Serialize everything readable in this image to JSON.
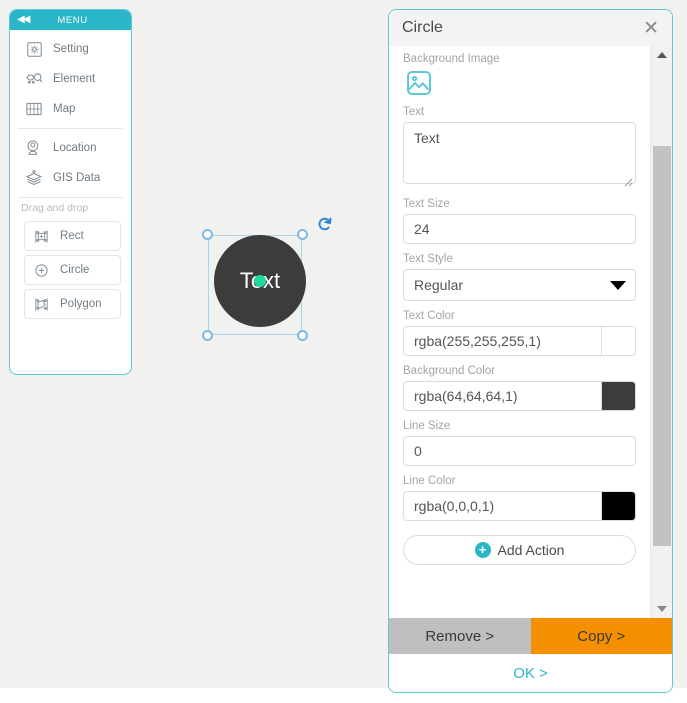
{
  "menu": {
    "title": "MENU",
    "collapse_icon": "double-chevron-left-icon",
    "items": [
      {
        "label": "Setting",
        "icon": "gear-icon"
      },
      {
        "label": "Element",
        "icon": "element-nodes-icon"
      },
      {
        "label": "Map",
        "icon": "grid-map-icon"
      },
      {
        "label": "Location",
        "icon": "location-pin-icon"
      },
      {
        "label": "GIS Data",
        "icon": "layers-icon"
      }
    ],
    "drag_label": "Drag and drop",
    "shapes": [
      {
        "label": "Rect",
        "icon": "rect-shape-icon"
      },
      {
        "label": "Circle",
        "icon": "circle-shape-icon"
      },
      {
        "label": "Polygon",
        "icon": "polygon-shape-icon"
      }
    ]
  },
  "canvas": {
    "background": "#f1f1f0",
    "shape": {
      "type": "circle",
      "text": "Text",
      "fill": "#3c3c3c",
      "text_color": "#ffffff",
      "anchor_color": "#1fd9a0",
      "rotate_icon": "rotate-handle-icon"
    }
  },
  "props": {
    "title": "Circle",
    "close_icon": "close-icon",
    "background_image": {
      "label": "Background Image",
      "icon": "image-placeholder-icon"
    },
    "text": {
      "label": "Text",
      "value": "Text"
    },
    "text_size": {
      "label": "Text Size",
      "value": "24"
    },
    "text_style": {
      "label": "Text Style",
      "value": "Regular",
      "caret_icon": "chevron-down-icon"
    },
    "text_color": {
      "label": "Text Color",
      "value": "rgba(255,255,255,1)",
      "swatch": "#ffffff"
    },
    "background_color": {
      "label": "Background Color",
      "value": "rgba(64,64,64,1)",
      "swatch": "#3c3c3c"
    },
    "line_size": {
      "label": "Line Size",
      "value": "0"
    },
    "line_color": {
      "label": "Line Color",
      "value": "rgba(0,0,0,1)",
      "swatch": "#000000"
    },
    "add_action": {
      "label": "Add Action",
      "icon": "plus-circle-icon"
    },
    "scrollbar": {
      "up_icon": "triangle-up-icon",
      "down_icon": "triangle-down-icon"
    },
    "footer": {
      "remove": "Remove >",
      "copy": "Copy >",
      "ok": "OK >",
      "remove_color": "#bfbfbf",
      "copy_color": "#f49000",
      "ok_color": "#29b6c9"
    }
  }
}
